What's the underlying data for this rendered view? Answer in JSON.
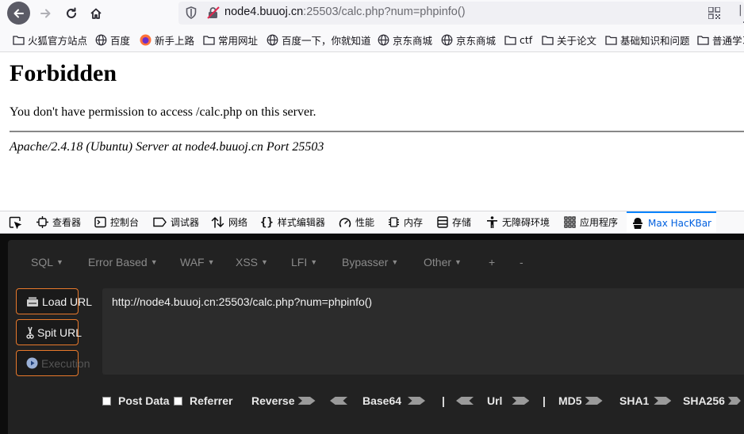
{
  "browser": {
    "url_host": "node4.buuoj.cn",
    "url_rest": ":25503/calc.php?num=phpinfo()",
    "bookmarks": [
      "火狐官方站点",
      "百度",
      "新手上路",
      "常用网址",
      "百度一下，你就知道",
      "京东商城",
      "京东商城",
      "ctf",
      "关于论文",
      "基础知识和问题",
      "普通学习"
    ]
  },
  "page": {
    "heading": "Forbidden",
    "message": "You don't have permission to access /calc.php on this server.",
    "address": "Apache/2.4.18 (Ubuntu) Server at node4.buuoj.cn Port 25503"
  },
  "devtools": {
    "tabs": [
      "查看器",
      "控制台",
      "调试器",
      "网络",
      "样式编辑器",
      "性能",
      "内存",
      "存储",
      "无障碍环境",
      "应用程序",
      "Max HacKBar"
    ]
  },
  "hackbar": {
    "menus": [
      "SQL",
      "Error Based",
      "WAF",
      "XSS",
      "LFI",
      "Bypasser",
      "Other",
      "+",
      "-"
    ],
    "load_url": "Load URL",
    "split_url": "Spit URL",
    "execution": "Execution",
    "url_value": "http://node4.buuoj.cn:25503/calc.php?num=phpinfo()",
    "post_data": "Post Data",
    "referrer": "Referrer",
    "reverse": "Reverse",
    "base64": "Base64",
    "pipe": "|",
    "url": "Url",
    "md5": "MD5",
    "sha1": "SHA1",
    "sha256": "SHA256"
  }
}
